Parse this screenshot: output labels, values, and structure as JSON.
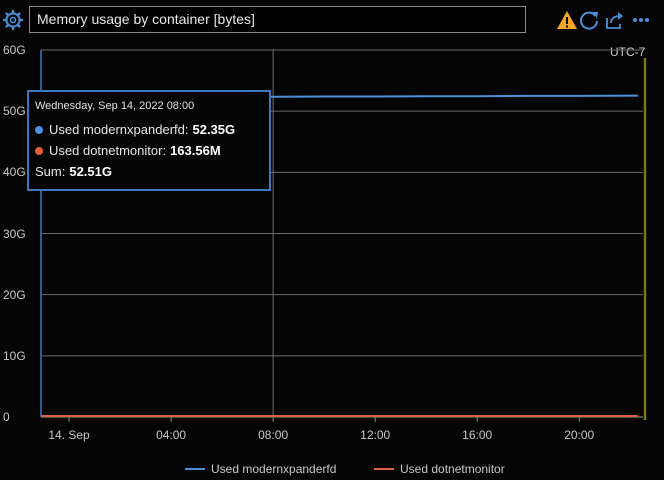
{
  "panel": {
    "title": "Memory usage by container [bytes]",
    "timezone": "UTC-7",
    "icons": {
      "settings": "gear-icon",
      "warning": "warning-icon",
      "refresh": "refresh-icon",
      "share": "share-icon",
      "more": "more-icon"
    },
    "colors": {
      "series1": "#4a90d9",
      "series2": "#e0623a",
      "warning": "#f5a623",
      "accent": "#3b78c0",
      "marker": "#7a7a10"
    }
  },
  "tooltip": {
    "date": "Wednesday, Sep 14, 2022 08:00",
    "rows": [
      {
        "label": "Used modernxpanderfd:",
        "value": "52.35G"
      },
      {
        "label": "Used dotnetmonitor:",
        "value": "163.56M"
      }
    ],
    "sum_label": "Sum:",
    "sum_value": "52.51G"
  },
  "legend": {
    "items": [
      {
        "name": "Used modernxpanderfd"
      },
      {
        "name": "Used dotnetmonitor"
      }
    ]
  },
  "chart_data": {
    "type": "line",
    "y_ticks": [
      "0",
      "10G",
      "20G",
      "30G",
      "40G",
      "50G",
      "60G"
    ],
    "ylim": [
      0,
      60
    ],
    "x_ticks": [
      {
        "label": "14. Sep",
        "hour": 0
      },
      {
        "label": "04:00",
        "hour": 4
      },
      {
        "label": "08:00",
        "hour": 8
      },
      {
        "label": "12:00",
        "hour": 12
      },
      {
        "label": "16:00",
        "hour": 16
      },
      {
        "label": "20:00",
        "hour": 20
      }
    ],
    "xlim": [
      -1.1,
      22.5
    ],
    "series": [
      {
        "name": "Used modernxpanderfd",
        "x": [
          -1.1,
          0,
          2,
          4,
          6,
          8,
          10,
          12,
          14,
          16,
          18,
          20,
          22.3
        ],
        "values": [
          52.3,
          52.35,
          52.35,
          52.35,
          52.35,
          52.35,
          52.4,
          52.4,
          52.45,
          52.45,
          52.5,
          52.5,
          52.55
        ]
      },
      {
        "name": "Used dotnetmonitor",
        "x": [
          -1.1,
          0,
          4,
          8,
          12,
          16,
          20,
          22.3
        ],
        "values": [
          0.16,
          0.16,
          0.16,
          0.16,
          0.16,
          0.16,
          0.16,
          0.16
        ]
      }
    ],
    "crosshair_hour": 8,
    "grid": true
  }
}
